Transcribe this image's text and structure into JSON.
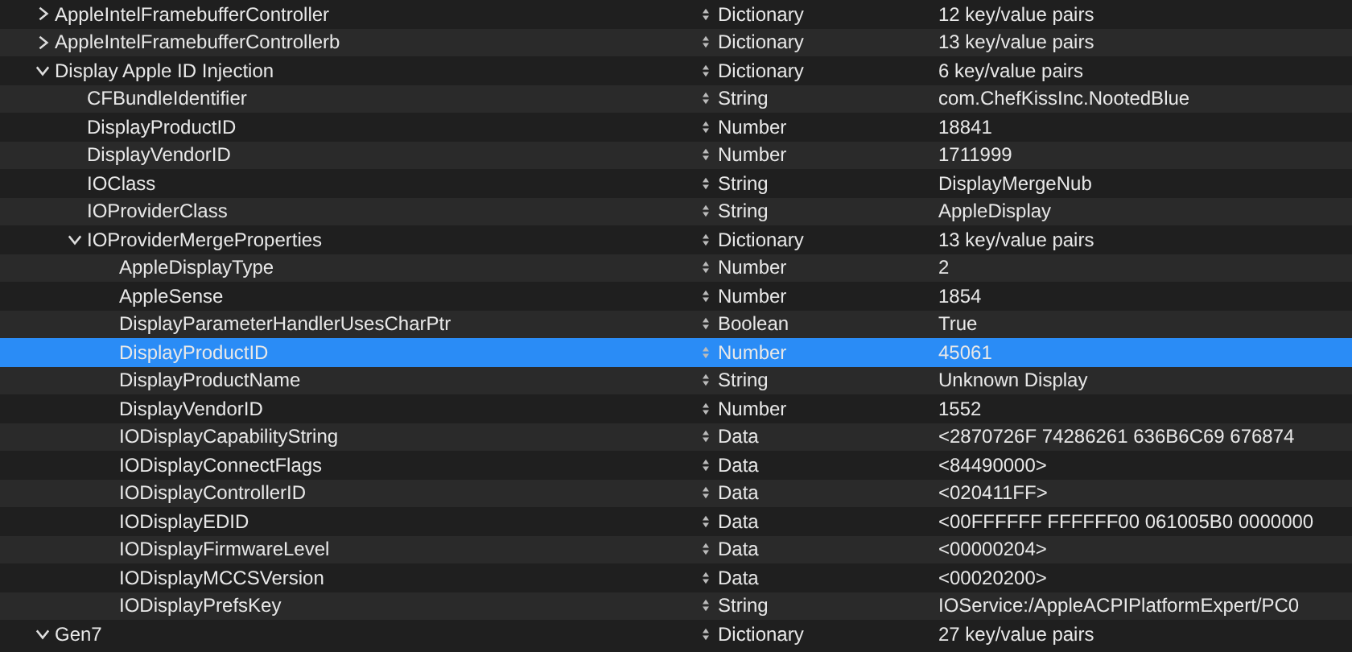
{
  "rows": [
    {
      "key": "AppleIntelFramebufferController",
      "type": "Dictionary",
      "value": "12 key/value pairs",
      "expanded": false,
      "selected": false
    },
    {
      "key": "AppleIntelFramebufferControllerb",
      "type": "Dictionary",
      "value": "13 key/value pairs",
      "expanded": false,
      "selected": false
    },
    {
      "key": "Display Apple ID Injection",
      "type": "Dictionary",
      "value": "6 key/value pairs",
      "expanded": true,
      "selected": false,
      "children": [
        {
          "key": "CFBundleIdentifier",
          "type": "String",
          "value": "com.ChefKissInc.NootedBlue",
          "selected": false
        },
        {
          "key": "DisplayProductID",
          "type": "Number",
          "value": "18841",
          "selected": false
        },
        {
          "key": "DisplayVendorID",
          "type": "Number",
          "value": "1711999",
          "selected": false
        },
        {
          "key": "IOClass",
          "type": "String",
          "value": "DisplayMergeNub",
          "selected": false
        },
        {
          "key": "IOProviderClass",
          "type": "String",
          "value": "AppleDisplay",
          "selected": false
        },
        {
          "key": "IOProviderMergeProperties",
          "type": "Dictionary",
          "value": "13 key/value pairs",
          "expanded": true,
          "selected": false,
          "children": [
            {
              "key": "AppleDisplayType",
              "type": "Number",
              "value": "2",
              "selected": false
            },
            {
              "key": "AppleSense",
              "type": "Number",
              "value": "1854",
              "selected": false
            },
            {
              "key": "DisplayParameterHandlerUsesCharPtr",
              "type": "Boolean",
              "value": "True",
              "selected": false
            },
            {
              "key": "DisplayProductID",
              "type": "Number",
              "value": "45061",
              "selected": true
            },
            {
              "key": "DisplayProductName",
              "type": "String",
              "value": "Unknown Display",
              "selected": false
            },
            {
              "key": "DisplayVendorID",
              "type": "Number",
              "value": "1552",
              "selected": false
            },
            {
              "key": "IODisplayCapabilityString",
              "type": "Data",
              "value": "<2870726F 74286261 636B6C69 676874",
              "selected": false
            },
            {
              "key": "IODisplayConnectFlags",
              "type": "Data",
              "value": "<84490000>",
              "selected": false
            },
            {
              "key": "IODisplayControllerID",
              "type": "Data",
              "value": "<020411FF>",
              "selected": false
            },
            {
              "key": "IODisplayEDID",
              "type": "Data",
              "value": "<00FFFFFF FFFFFF00 061005B0 0000000",
              "selected": false
            },
            {
              "key": "IODisplayFirmwareLevel",
              "type": "Data",
              "value": "<00000204>",
              "selected": false
            },
            {
              "key": "IODisplayMCCSVersion",
              "type": "Data",
              "value": "<00020200>",
              "selected": false
            },
            {
              "key": "IODisplayPrefsKey",
              "type": "String",
              "value": "IOService:/AppleACPIPlatformExpert/PC0",
              "selected": false
            }
          ]
        }
      ]
    },
    {
      "key": "Gen7",
      "type": "Dictionary",
      "value": "27 key/value pairs",
      "expanded": true,
      "selected": false
    }
  ]
}
